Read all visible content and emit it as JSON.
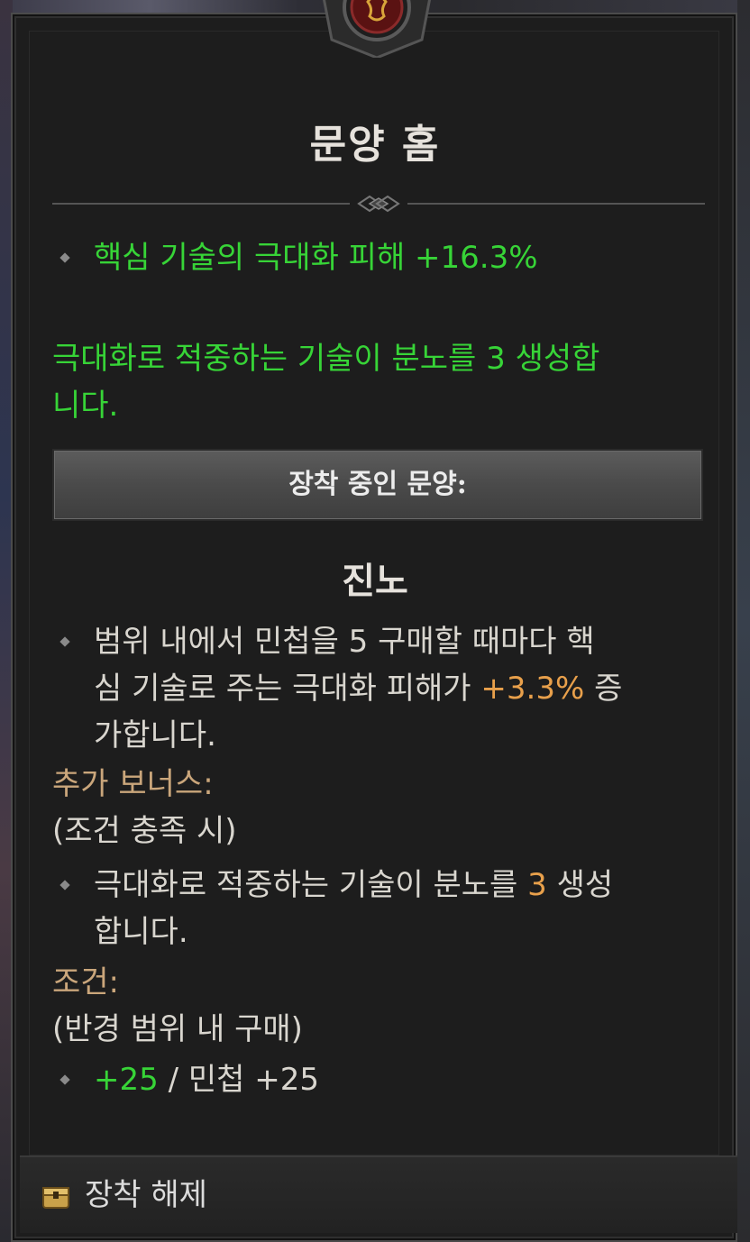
{
  "item": {
    "title": "문양 홈",
    "socket_affix": {
      "bullet_text": "핵심 기술의 극대화 피해 +16.3%",
      "effect_line1": "극대화로 적중하는 기술이 분노를 3 생성합",
      "effect_line2": "니다."
    }
  },
  "equipped": {
    "banner_label": "장착 중인 문양:",
    "glyph_name": "진노",
    "effect": {
      "line1": "범위 내에서 민첩을 5 구매할 때마다 핵",
      "line2_a": "심 기술로 주는 극대화 피해가",
      "line2_value": "+3.3%",
      "line2_b": "증",
      "line3": "가합니다."
    },
    "bonus_label": "추가 보너스:",
    "bonus_condition": "(조건 충족 시)",
    "bonus_effect": {
      "line1_a": "극대화로 적중하는 기술이 분노를",
      "line1_value": "3",
      "line1_b": "생성",
      "line2": "합니다."
    },
    "requirement_label": "조건:",
    "requirement_desc": "(반경 범위 내 구매)",
    "requirement_value": {
      "current": "+25",
      "separator": "/",
      "required": "민첩 +25"
    }
  },
  "footer": {
    "action_label": "장착 해제",
    "icon": "unequip-chest-icon"
  },
  "colors": {
    "green": "#37d437",
    "orange": "#e8a04b",
    "tan": "#caa67b",
    "text": "#d9d6cf"
  }
}
